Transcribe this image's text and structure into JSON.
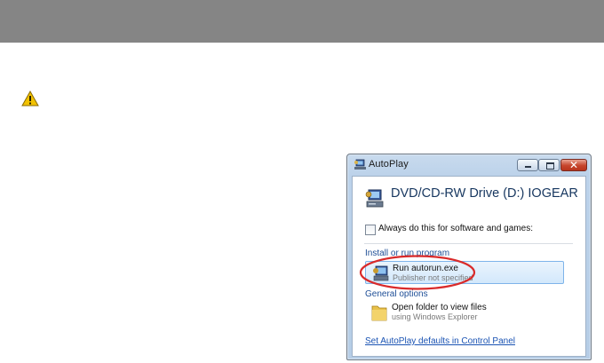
{
  "window": {
    "title": "AutoPlay",
    "drive_title": "DVD/CD-RW Drive (D:) IOGEAR",
    "always_checkbox_label": "Always do this for software and games:",
    "always_checked": false,
    "install_section": "Install or run program",
    "run_item": {
      "label": "Run autorun.exe",
      "publisher": "Publisher not specified",
      "icon": "autorun-program-icon"
    },
    "general_section": "General options",
    "folder_item": {
      "label": "Open folder to view files",
      "subtitle": "using Windows Explorer",
      "icon": "folder-icon"
    },
    "control_panel_link": "Set AutoPlay defaults in Control Panel"
  },
  "colors": {
    "header_bar": "#858585",
    "highlight_oval": "#d92a2a",
    "warning": "#f2c200"
  },
  "icons": [
    "warning-icon",
    "autoplay-icon",
    "drive-icon",
    "minimize-icon",
    "maximize-icon",
    "close-icon"
  ]
}
